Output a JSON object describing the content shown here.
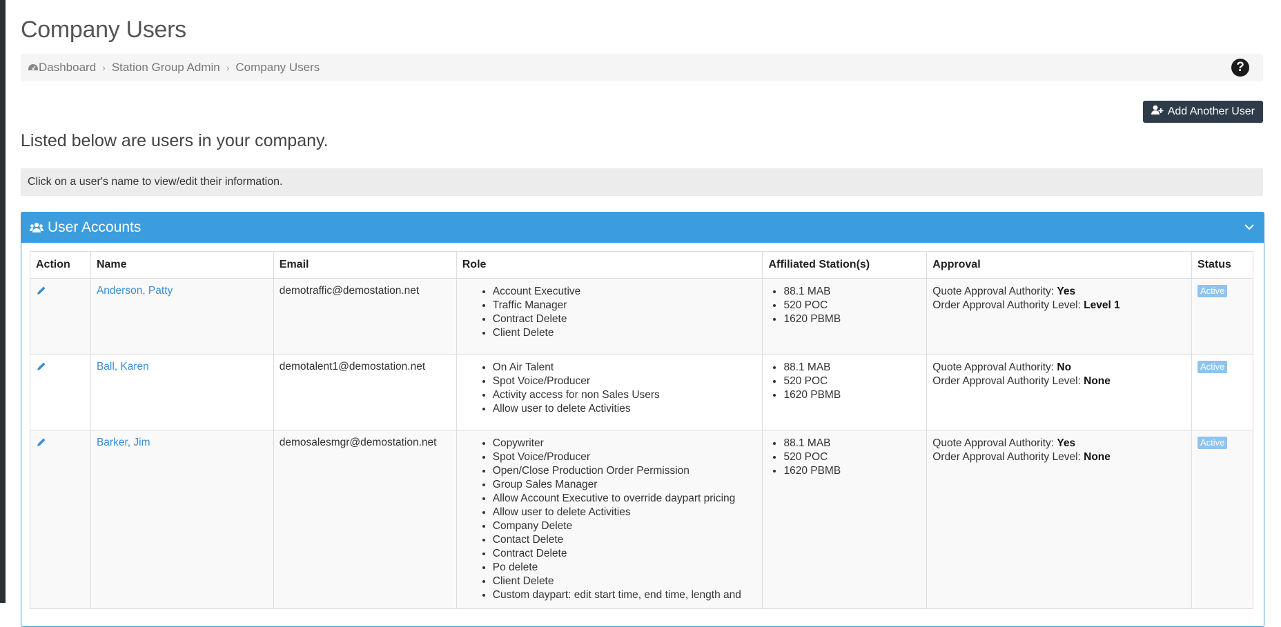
{
  "page": {
    "title": "Company Users",
    "intro": "Listed below are users in your company.",
    "hint": "Click on a user's name to view/edit their information."
  },
  "breadcrumb": {
    "items": [
      "Dashboard",
      "Station Group Admin",
      "Company Users"
    ],
    "help_icon": "question-circle-icon"
  },
  "toolbar": {
    "add_user_label": "Add Another User"
  },
  "panel": {
    "title": "User Accounts"
  },
  "table": {
    "headers": [
      "Action",
      "Name",
      "Email",
      "Role",
      "Affiliated Station(s)",
      "Approval",
      "Status"
    ],
    "rows": [
      {
        "name": "Anderson, Patty",
        "email": "demotraffic@demostation.net",
        "roles": [
          "Account Executive",
          "Traffic Manager",
          "Contract Delete",
          "Client Delete"
        ],
        "stations": [
          "88.1 MAB",
          "520 POC",
          "1620 PBMB"
        ],
        "quote_label": "Quote Approval Authority: ",
        "quote_value": "Yes",
        "order_label": "Order Approval Authority Level: ",
        "order_value": "Level 1",
        "status": "Active"
      },
      {
        "name": "Ball, Karen",
        "email": "demotalent1@demostation.net",
        "roles": [
          "On Air Talent",
          "Spot Voice/Producer",
          "Activity access for non Sales Users",
          "Allow user to delete Activities"
        ],
        "stations": [
          "88.1 MAB",
          "520 POC",
          "1620 PBMB"
        ],
        "quote_label": "Quote Approval Authority: ",
        "quote_value": "No",
        "order_label": "Order Approval Authority Level: ",
        "order_value": "None",
        "status": "Active"
      },
      {
        "name": "Barker, Jim",
        "email": "demosalesmgr@demostation.net",
        "roles": [
          "Copywriter",
          "Spot Voice/Producer",
          "Open/Close Production Order Permission",
          "Group Sales Manager",
          "Allow Account Executive to override daypart pricing",
          "Allow user to delete Activities",
          "Company Delete",
          "Contact Delete",
          "Contract Delete",
          "Po delete",
          "Client Delete",
          "Custom daypart: edit start time, end time, length and"
        ],
        "stations": [
          "88.1 MAB",
          "520 POC",
          "1620 PBMB"
        ],
        "quote_label": "Quote Approval Authority: ",
        "quote_value": "Yes",
        "order_label": "Order Approval Authority Level: ",
        "order_value": "None",
        "status": "Active"
      }
    ]
  },
  "colors": {
    "panel_header": "#3b9ddd",
    "link": "#3a8dd1",
    "button_dark": "#2e3b49",
    "badge": "#8ec4ee"
  }
}
